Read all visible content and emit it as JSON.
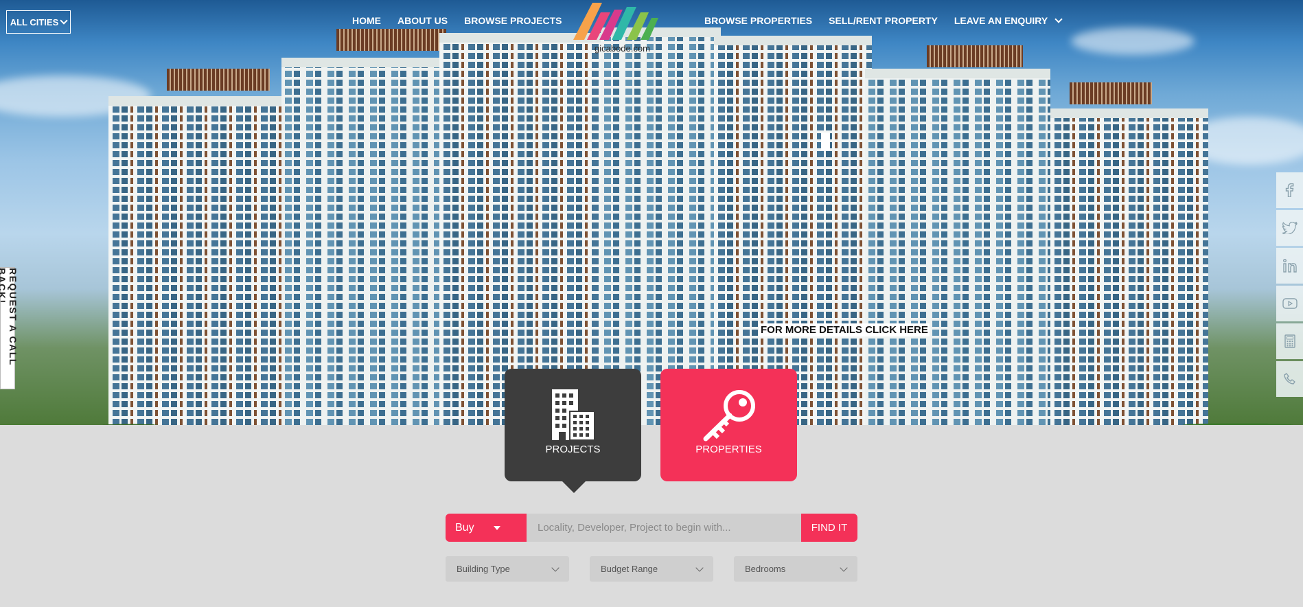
{
  "header": {
    "city_selector": "ALL CITIES",
    "nav_left": [
      "HOME",
      "ABOUT US",
      "BROWSE PROJECTS"
    ],
    "nav_right": [
      "BROWSE PROPERTIES",
      "SELL/RENT PROPERTY",
      "LEAVE AN ENQUIRY"
    ],
    "logo_text": "gicabode.com"
  },
  "hero": {
    "details_link": "FOR MORE DETAILS CLICK HERE"
  },
  "side": {
    "callback": "REQUEST A CALL BACK!",
    "social_icons": [
      "facebook-icon",
      "twitter-icon",
      "linkedin-icon",
      "youtube-icon",
      "calculator-icon",
      "phone-icon"
    ]
  },
  "categories": {
    "projects": "PROJECTS",
    "properties": "PROPERTIES"
  },
  "search": {
    "type_value": "Buy",
    "placeholder": "Locality, Developer, Project to begin with...",
    "button": "FIND IT"
  },
  "filters": {
    "building_type": "Building Type",
    "budget_range": "Budget Range",
    "bedrooms": "Bedrooms"
  },
  "colors": {
    "accent": "#f43158",
    "dark_card": "#3d3d3d",
    "page_bg": "#dcdcdc"
  }
}
